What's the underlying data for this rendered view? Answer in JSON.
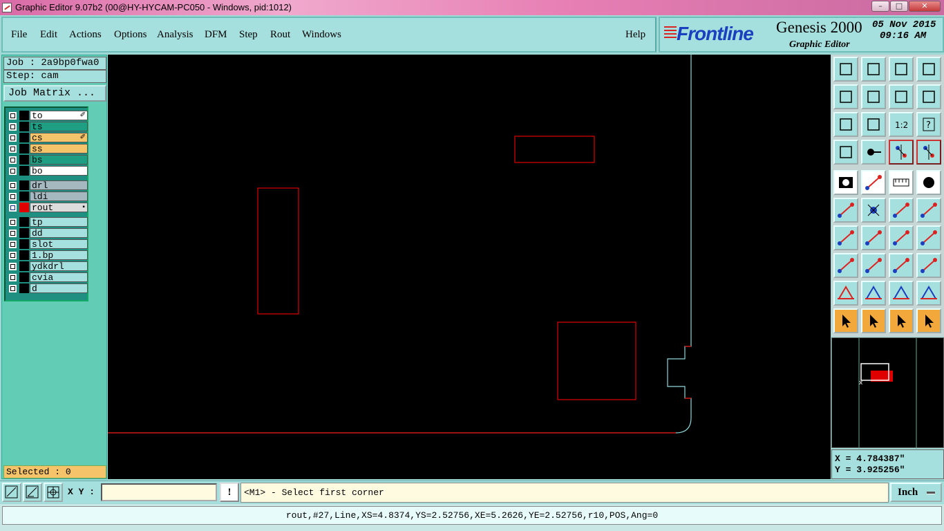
{
  "window": {
    "title": "Graphic Editor 9.07b2 (00@HY-HYCAM-PC050 - Windows, pid:1012)",
    "min_label": "–",
    "max_label": "□",
    "close_label": "✕"
  },
  "menu": {
    "items": [
      "File",
      "Edit",
      "Actions",
      "Options",
      "Analysis",
      "DFM",
      "Step",
      "Rout",
      "Windows"
    ],
    "help": "Help"
  },
  "brand": {
    "logo_text": "Frontline",
    "product": "Genesis 2000",
    "subtitle": "Graphic Editor",
    "date": "05 Nov 2015",
    "time": "09:16 AM"
  },
  "job": {
    "job_line": "Job : 2a9bp0fwa0",
    "step_line": "Step: cam",
    "matrix_button": "Job Matrix ..."
  },
  "layers": [
    {
      "name": "to",
      "color": "#ffffff",
      "mark": "✐"
    },
    {
      "name": "ts",
      "color": "#1e9e83",
      "mark": ""
    },
    {
      "name": "cs",
      "color": "#f5c36a",
      "mark": "✐"
    },
    {
      "name": "ss",
      "color": "#f5c36a",
      "mark": ""
    },
    {
      "name": "bs",
      "color": "#1e9e83",
      "mark": ""
    },
    {
      "name": "bo",
      "color": "#ffffff",
      "mark": ""
    },
    {
      "name": "drl",
      "color": "#a5b8c0",
      "mark": ""
    },
    {
      "name": "ldi",
      "color": "#a5b8c0",
      "mark": ""
    },
    {
      "name": "rout",
      "color": "#dcdcdc",
      "mark": "▪",
      "active": true
    },
    {
      "name": "tp",
      "color": "#a6e0de",
      "mark": ""
    },
    {
      "name": "dd",
      "color": "#a6e0de",
      "mark": ""
    },
    {
      "name": "slot",
      "color": "#a6e0de",
      "mark": ""
    },
    {
      "name": "1.bp",
      "color": "#a6e0de",
      "mark": ""
    },
    {
      "name": "ydkdrl",
      "color": "#a6e0de",
      "mark": ""
    },
    {
      "name": "cvia",
      "color": "#a6e0de",
      "mark": ""
    },
    {
      "name": "d",
      "color": "#a6e0de",
      "mark": ""
    }
  ],
  "selection": {
    "label": "Selected : 0"
  },
  "coordinates": {
    "x": "X = 4.784387\"",
    "y": "Y = 3.925256\""
  },
  "command": {
    "xy_label": "X Y :",
    "xy_value": "",
    "bang": "!",
    "prompt": "<M1> - Select first corner",
    "units": "Inch"
  },
  "status": {
    "text": "rout,#27,Line,XS=4.8374,YS=2.52756,XE=5.2626,YE=2.52756,r10,POS,Ang=0"
  },
  "colors": {
    "feature": "#e00000",
    "profile": "#8fd8dc",
    "canvas": "#000000"
  },
  "toolbar_icons": [
    "zoom-home-icon",
    "zoom-page-icon",
    "home-icon",
    "window-icon",
    "pan-left-icon",
    "pan-right-icon",
    "undo-view-icon",
    "redo-view-icon",
    "zoom-fit-icon",
    "zoom-center-icon",
    "scale-1-2-icon",
    "help-icon",
    "settings-icon",
    "pad-icon",
    "net-highlight-icon",
    "net-highlight-2-icon",
    "camera-icon",
    "erase-icon",
    "ruler-icon",
    "dot-icon",
    "connect-icon",
    "cross-icon",
    "snap-point-icon",
    "snap-point-2-icon",
    "line-angle-icon",
    "line-icon",
    "arc-icon",
    "mirror-icon",
    "node-icon",
    "cut-icon",
    "measure-icon",
    "array-icon",
    "triangle-icon",
    "vertex-icon",
    "vertex-2-icon",
    "vertex-3-icon",
    "select-icon",
    "select-box-icon",
    "select-circle-icon",
    "select-path-icon"
  ]
}
